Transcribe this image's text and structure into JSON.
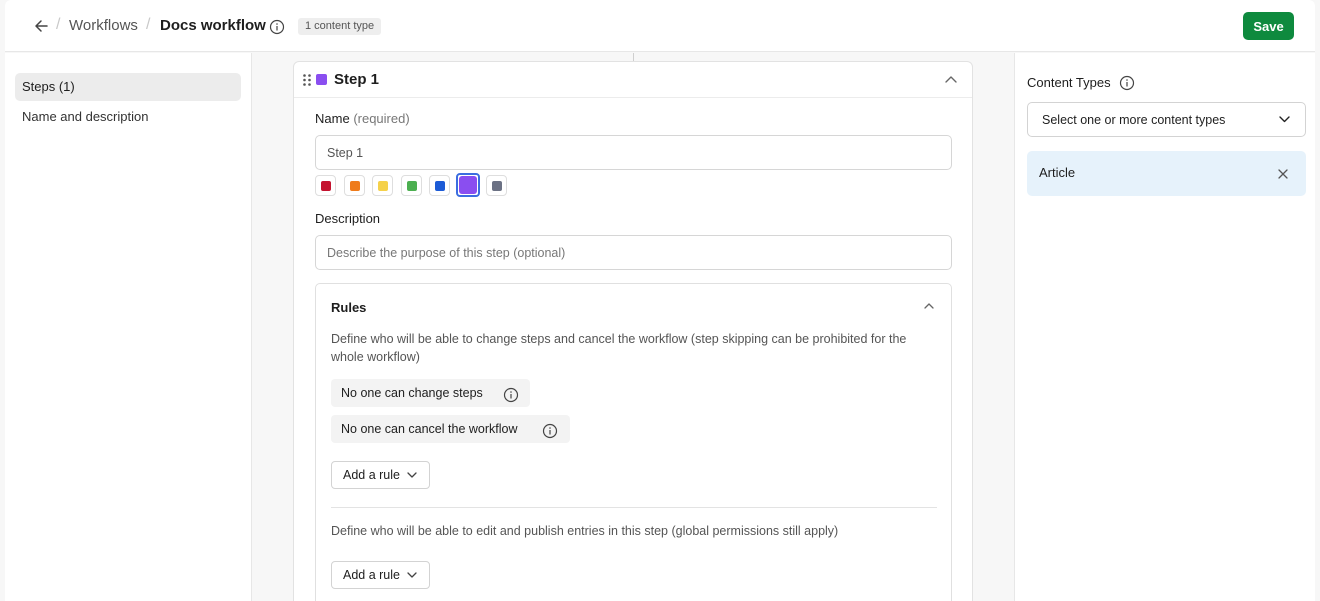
{
  "header": {
    "breadcrumb_parent": "Workflows",
    "breadcrumb_current": "Docs workflow",
    "content_type_badge": "1 content type",
    "save_label": "Save"
  },
  "sidebar": {
    "items": [
      {
        "label": "Steps (1)",
        "active": true
      },
      {
        "label": "Name and description",
        "active": false
      }
    ]
  },
  "step": {
    "title": "Step 1",
    "color": "#8a4ef0",
    "name_label": "Name",
    "name_required": "(required)",
    "name_value": "Step 1",
    "colors": [
      "#c4122f",
      "#ef7b1a",
      "#f5d14a",
      "#4caf50",
      "#1c5bd6",
      "#8a4ef0",
      "#6b7184"
    ],
    "selected_color_index": 5,
    "description_label": "Description",
    "description_placeholder": "Describe the purpose of this step (optional)"
  },
  "rules": {
    "title": "Rules",
    "change_desc": "Define who will be able to change steps and cancel the workflow (step skipping can be prohibited for the whole workflow)",
    "pill_change": "No one can change steps",
    "pill_cancel": "No one can cancel the workflow",
    "add_rule_label": "Add a rule",
    "edit_desc": "Define who will be able to edit and publish entries in this step (global permissions still apply)",
    "add_rule_label_2": "Add a rule"
  },
  "content_types": {
    "title": "Content Types",
    "select_placeholder": "Select one or more content types",
    "selected": [
      "Article"
    ]
  }
}
